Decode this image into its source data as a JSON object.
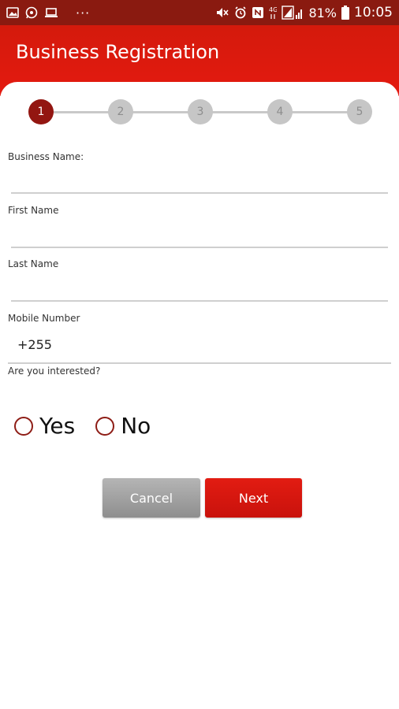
{
  "status_bar": {
    "battery_percent": "81%",
    "time": "10:05",
    "overflow": "···",
    "network": "4G"
  },
  "app_bar": {
    "title": "Business Registration"
  },
  "stepper": {
    "steps": [
      "1",
      "2",
      "3",
      "4",
      "5"
    ],
    "current_step": 1
  },
  "form": {
    "business_name_label": "Business Name:",
    "business_name_value": "",
    "first_name_label": "First Name",
    "first_name_value": "",
    "last_name_label": "Last Name",
    "last_name_value": "",
    "mobile_label": "Mobile Number",
    "mobile_value": "+255",
    "interested_label": "Are you interested?",
    "options": [
      "Yes",
      "No"
    ]
  },
  "buttons": {
    "cancel": "Cancel",
    "next": "Next"
  },
  "colors": {
    "primary": "#e41a10",
    "status_bar": "#8a1a10",
    "step_active": "#931611",
    "step_inactive": "#c6c6c6"
  }
}
